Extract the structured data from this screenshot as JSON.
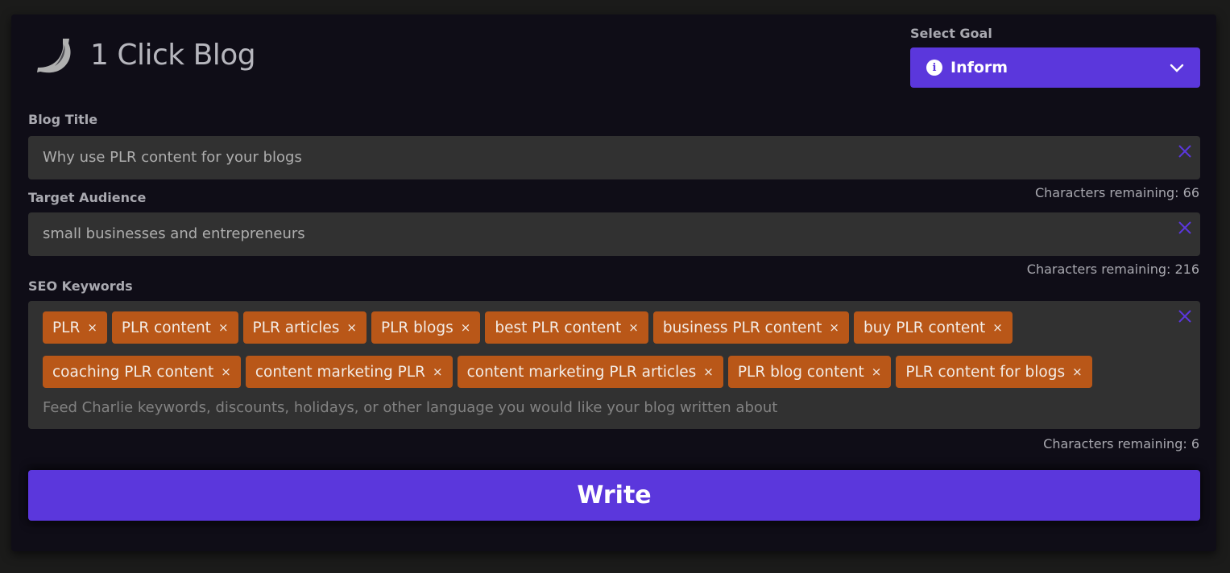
{
  "app": {
    "title": "1 Click Blog",
    "logo_icon": "banana-icon"
  },
  "goal": {
    "label": "Select Goal",
    "selected": "Inform",
    "icon": "info-icon",
    "accent_color": "#5b37dc"
  },
  "blog_title": {
    "label": "Blog Title",
    "value": "Why use PLR content for your blogs",
    "counter": "Characters remaining: 66"
  },
  "target_audience": {
    "label": "Target Audience",
    "value": "small businesses and entrepreneurs",
    "counter": "Characters remaining: 216"
  },
  "seo_keywords": {
    "label": "SEO Keywords",
    "tags": [
      "PLR",
      "PLR content",
      "PLR articles",
      "PLR blogs",
      "best PLR content",
      "business PLR content",
      "buy PLR content",
      "coaching PLR content",
      "content marketing PLR",
      "content marketing PLR articles",
      "PLR blog content",
      "PLR content for blogs"
    ],
    "tag_remove_symbol": "×",
    "tag_color": "#b95718",
    "placeholder": "Feed Charlie keywords, discounts, holidays, or other language you would like your blog written about",
    "counter": "Characters remaining: 6"
  },
  "actions": {
    "write_label": "Write"
  }
}
